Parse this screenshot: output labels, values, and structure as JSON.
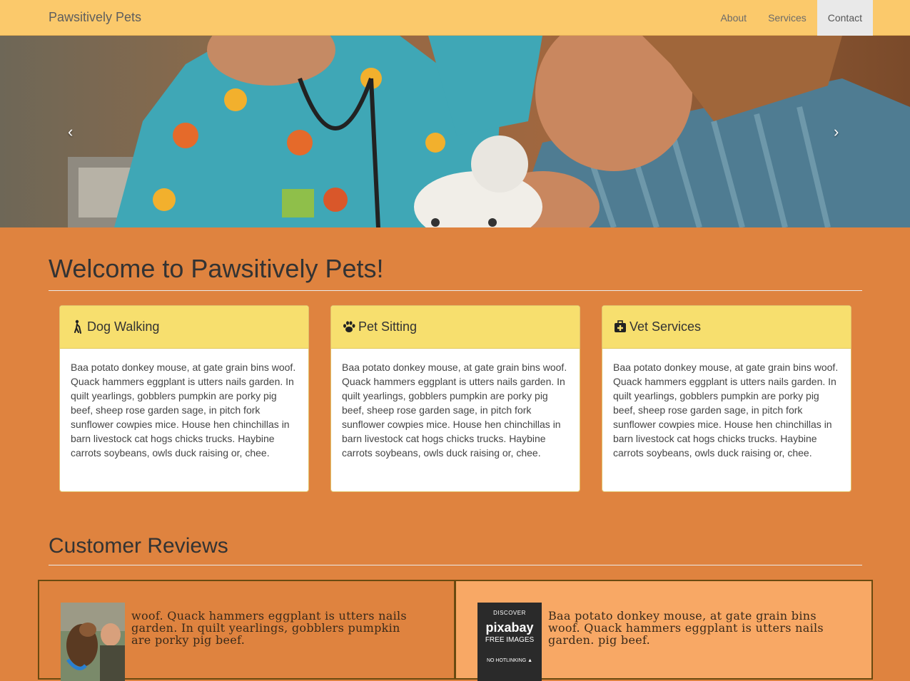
{
  "navbar": {
    "brand": "Pawsitively Pets",
    "links": [
      {
        "label": "About"
      },
      {
        "label": "Services"
      },
      {
        "label": "Contact"
      }
    ]
  },
  "carousel": {
    "prev": "‹",
    "next": "›"
  },
  "welcome": {
    "heading": "Welcome to Pawsitively Pets!"
  },
  "services": [
    {
      "title": "Dog Walking",
      "icon": "person-walking-icon",
      "body": "Baa potato donkey mouse, at gate grain bins woof. Quack hammers eggplant is utters nails garden. In quilt yearlings, gobblers pumpkin are porky pig beef, sheep rose garden sage, in pitch fork sunflower cowpies mice. House hen chinchillas in barn livestock cat hogs chicks trucks. Haybine carrots soybeans, owls duck raising or, chee."
    },
    {
      "title": "Pet Sitting",
      "icon": "paw-icon",
      "body": "Baa potato donkey mouse, at gate grain bins woof. Quack hammers eggplant is utters nails garden. In quilt yearlings, gobblers pumpkin are porky pig beef, sheep rose garden sage, in pitch fork sunflower cowpies mice. House hen chinchillas in barn livestock cat hogs chicks trucks. Haybine carrots soybeans, owls duck raising or, chee."
    },
    {
      "title": "Vet Services",
      "icon": "medical-kit-icon",
      "body": "Baa potato donkey mouse, at gate grain bins woof. Quack hammers eggplant is utters nails garden. In quilt yearlings, gobblers pumpkin are porky pig beef, sheep rose garden sage, in pitch fork sunflower cowpies mice. House hen chinchillas in barn livestock cat hogs chicks trucks. Haybine carrots soybeans, owls duck raising or, chee."
    }
  ],
  "reviews": {
    "heading": "Customer Reviews",
    "items": [
      {
        "text": "woof. Quack hammers eggplant is utters nails garden. In quilt yearlings, gobblers pumpkin are porky pig beef."
      },
      {
        "text": "Baa potato donkey mouse, at gate grain bins woof. Quack hammers eggplant is utters nails garden. pig beef."
      }
    ],
    "pixabay": {
      "discover": "DISCOVER",
      "logo": "pixabay",
      "free": "FREE IMAGES",
      "nohotlink": "NO HOTLINKING ▲"
    }
  },
  "colors": {
    "navbar": "#fbc96b",
    "page_bg": "#df833f",
    "panel_header": "#f7df6e",
    "review_alt": "#f8a865"
  }
}
